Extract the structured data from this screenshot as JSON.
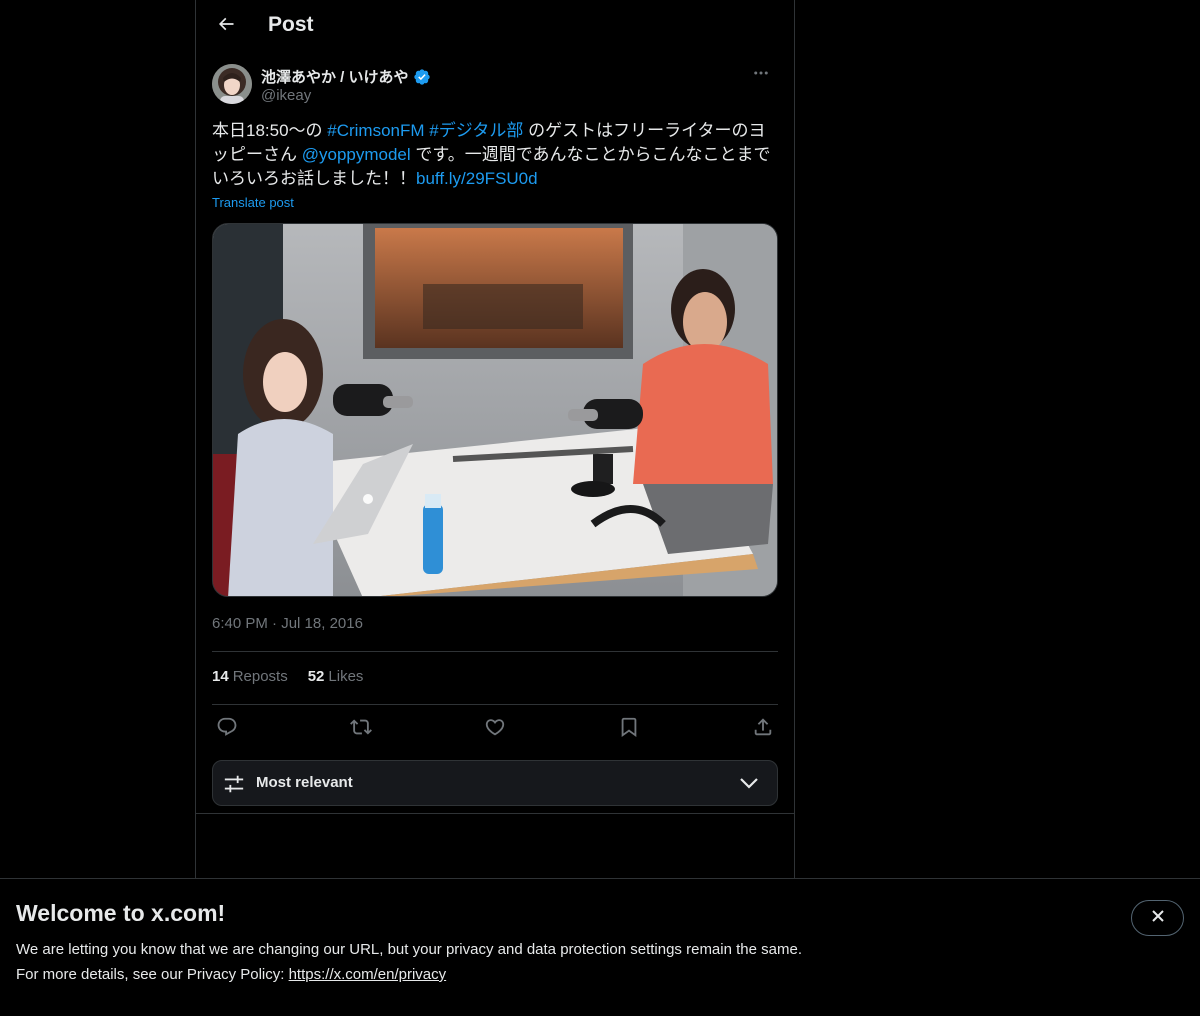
{
  "header": {
    "title": "Post"
  },
  "post": {
    "author_name": "池澤あやか / いけあや",
    "author_handle": "@ikeay",
    "text_parts": {
      "p1": "本日18:50〜の ",
      "hashtag1": "#CrimsonFM",
      "space1": " ",
      "hashtag2": "#デジタル部",
      "p2": " のゲストはフリーライターのヨッピーさん ",
      "mention": "@yoppymodel",
      "p3": " です。一週間であんなことからこんなことまでいろいろお話しました！！",
      "link": "buff.ly/29FSU0d"
    },
    "translate_label": "Translate post",
    "time": "6:40 PM",
    "date_separator": "·",
    "date": "Jul 18, 2016",
    "reposts_count": "14",
    "reposts_label": "Reposts",
    "likes_count": "52",
    "likes_label": "Likes"
  },
  "sort": {
    "label": "Most relevant"
  },
  "banner": {
    "title": "Welcome to x.com!",
    "line1": "We are letting you know that we are changing our URL, but your privacy and data protection settings remain the same.",
    "line2_prefix": "For more details, see our Privacy Policy: ",
    "line2_link": "https://x.com/en/privacy"
  },
  "colors": {
    "accent": "#1d9bf0",
    "background": "#000000",
    "text_primary": "#e7e9ea",
    "text_secondary": "#71767b",
    "border": "#2f3336"
  },
  "icons": {
    "back": "arrow-left-icon",
    "verified": "verified-badge-icon",
    "more": "more-horizontal-icon",
    "reply": "reply-icon",
    "repost": "repost-icon",
    "like": "heart-icon",
    "bookmark": "bookmark-icon",
    "share": "share-icon",
    "sort": "sliders-icon",
    "chevron": "chevron-down-icon",
    "close": "close-icon"
  }
}
